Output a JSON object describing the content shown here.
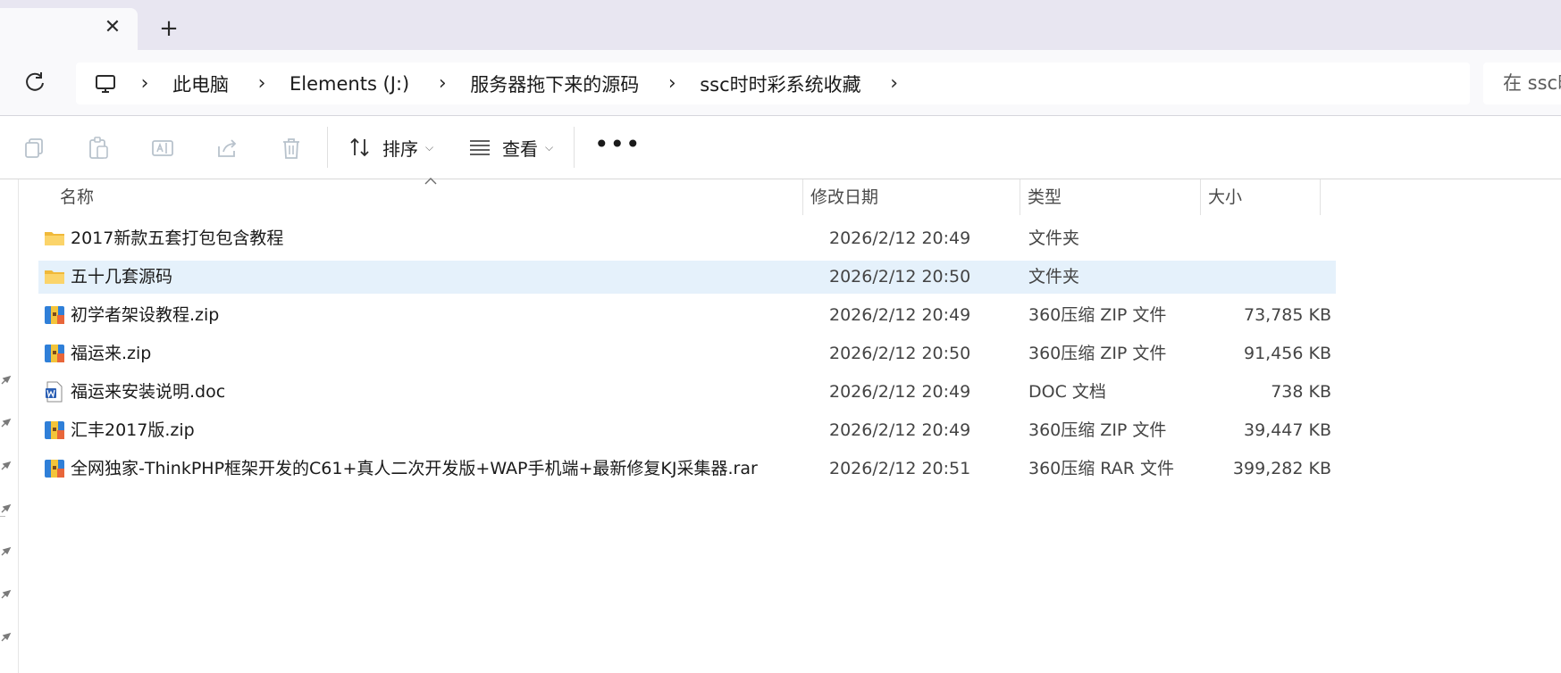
{
  "tabs": {
    "close_glyph": "✕",
    "new_glyph": "+"
  },
  "address": {
    "breadcrumb": [
      "此电脑",
      "Elements (J:)",
      "服务器拖下来的源码",
      "ssc时时彩系统收藏"
    ],
    "search_placeholder": "在 ssc时"
  },
  "toolbar": {
    "copy_icon": "copy-icon",
    "paste_icon": "paste-icon",
    "rename_icon": "rename-icon",
    "share_icon": "share-icon",
    "delete_icon": "delete-icon",
    "sort_label": "排序",
    "view_label": "查看",
    "more_label": "•••"
  },
  "columns": {
    "name": "名称",
    "date": "修改日期",
    "type": "类型",
    "size": "大小"
  },
  "files": [
    {
      "name": "2017新款五套打包包含教程",
      "date": "2026/2/12 20:49",
      "type": "文件夹",
      "size": "",
      "icon": "folder-icon"
    },
    {
      "name": "五十几套源码",
      "date": "2026/2/12 20:50",
      "type": "文件夹",
      "size": "",
      "icon": "folder-icon",
      "selected": true
    },
    {
      "name": "初学者架设教程.zip",
      "date": "2026/2/12 20:49",
      "type": "360压缩 ZIP 文件",
      "size": "73,785 KB",
      "icon": "archive-icon"
    },
    {
      "name": "福运来.zip",
      "date": "2026/2/12 20:50",
      "type": "360压缩 ZIP 文件",
      "size": "91,456 KB",
      "icon": "archive-icon"
    },
    {
      "name": "福运来安装说明.doc",
      "date": "2026/2/12 20:49",
      "type": "DOC 文档",
      "size": "738 KB",
      "icon": "word-doc-icon"
    },
    {
      "name": "汇丰2017版.zip",
      "date": "2026/2/12 20:49",
      "type": "360压缩 ZIP 文件",
      "size": "39,447 KB",
      "icon": "archive-icon"
    },
    {
      "name": "全网独家-ThinkPHP框架开发的C61+真人二次开发版+WAP手机端+最新修复KJ采集器.rar",
      "date": "2026/2/12 20:51",
      "type": "360压缩 RAR 文件",
      "size": "399,282 KB",
      "icon": "archive-icon"
    }
  ],
  "colors": {
    "tabstrip_bg": "#e8e6f1",
    "selected_row": "#e5f1fb",
    "folder_yellow": "#f5c542",
    "archive_blue": "#2f7fd8",
    "word_blue": "#2b5fb4"
  }
}
